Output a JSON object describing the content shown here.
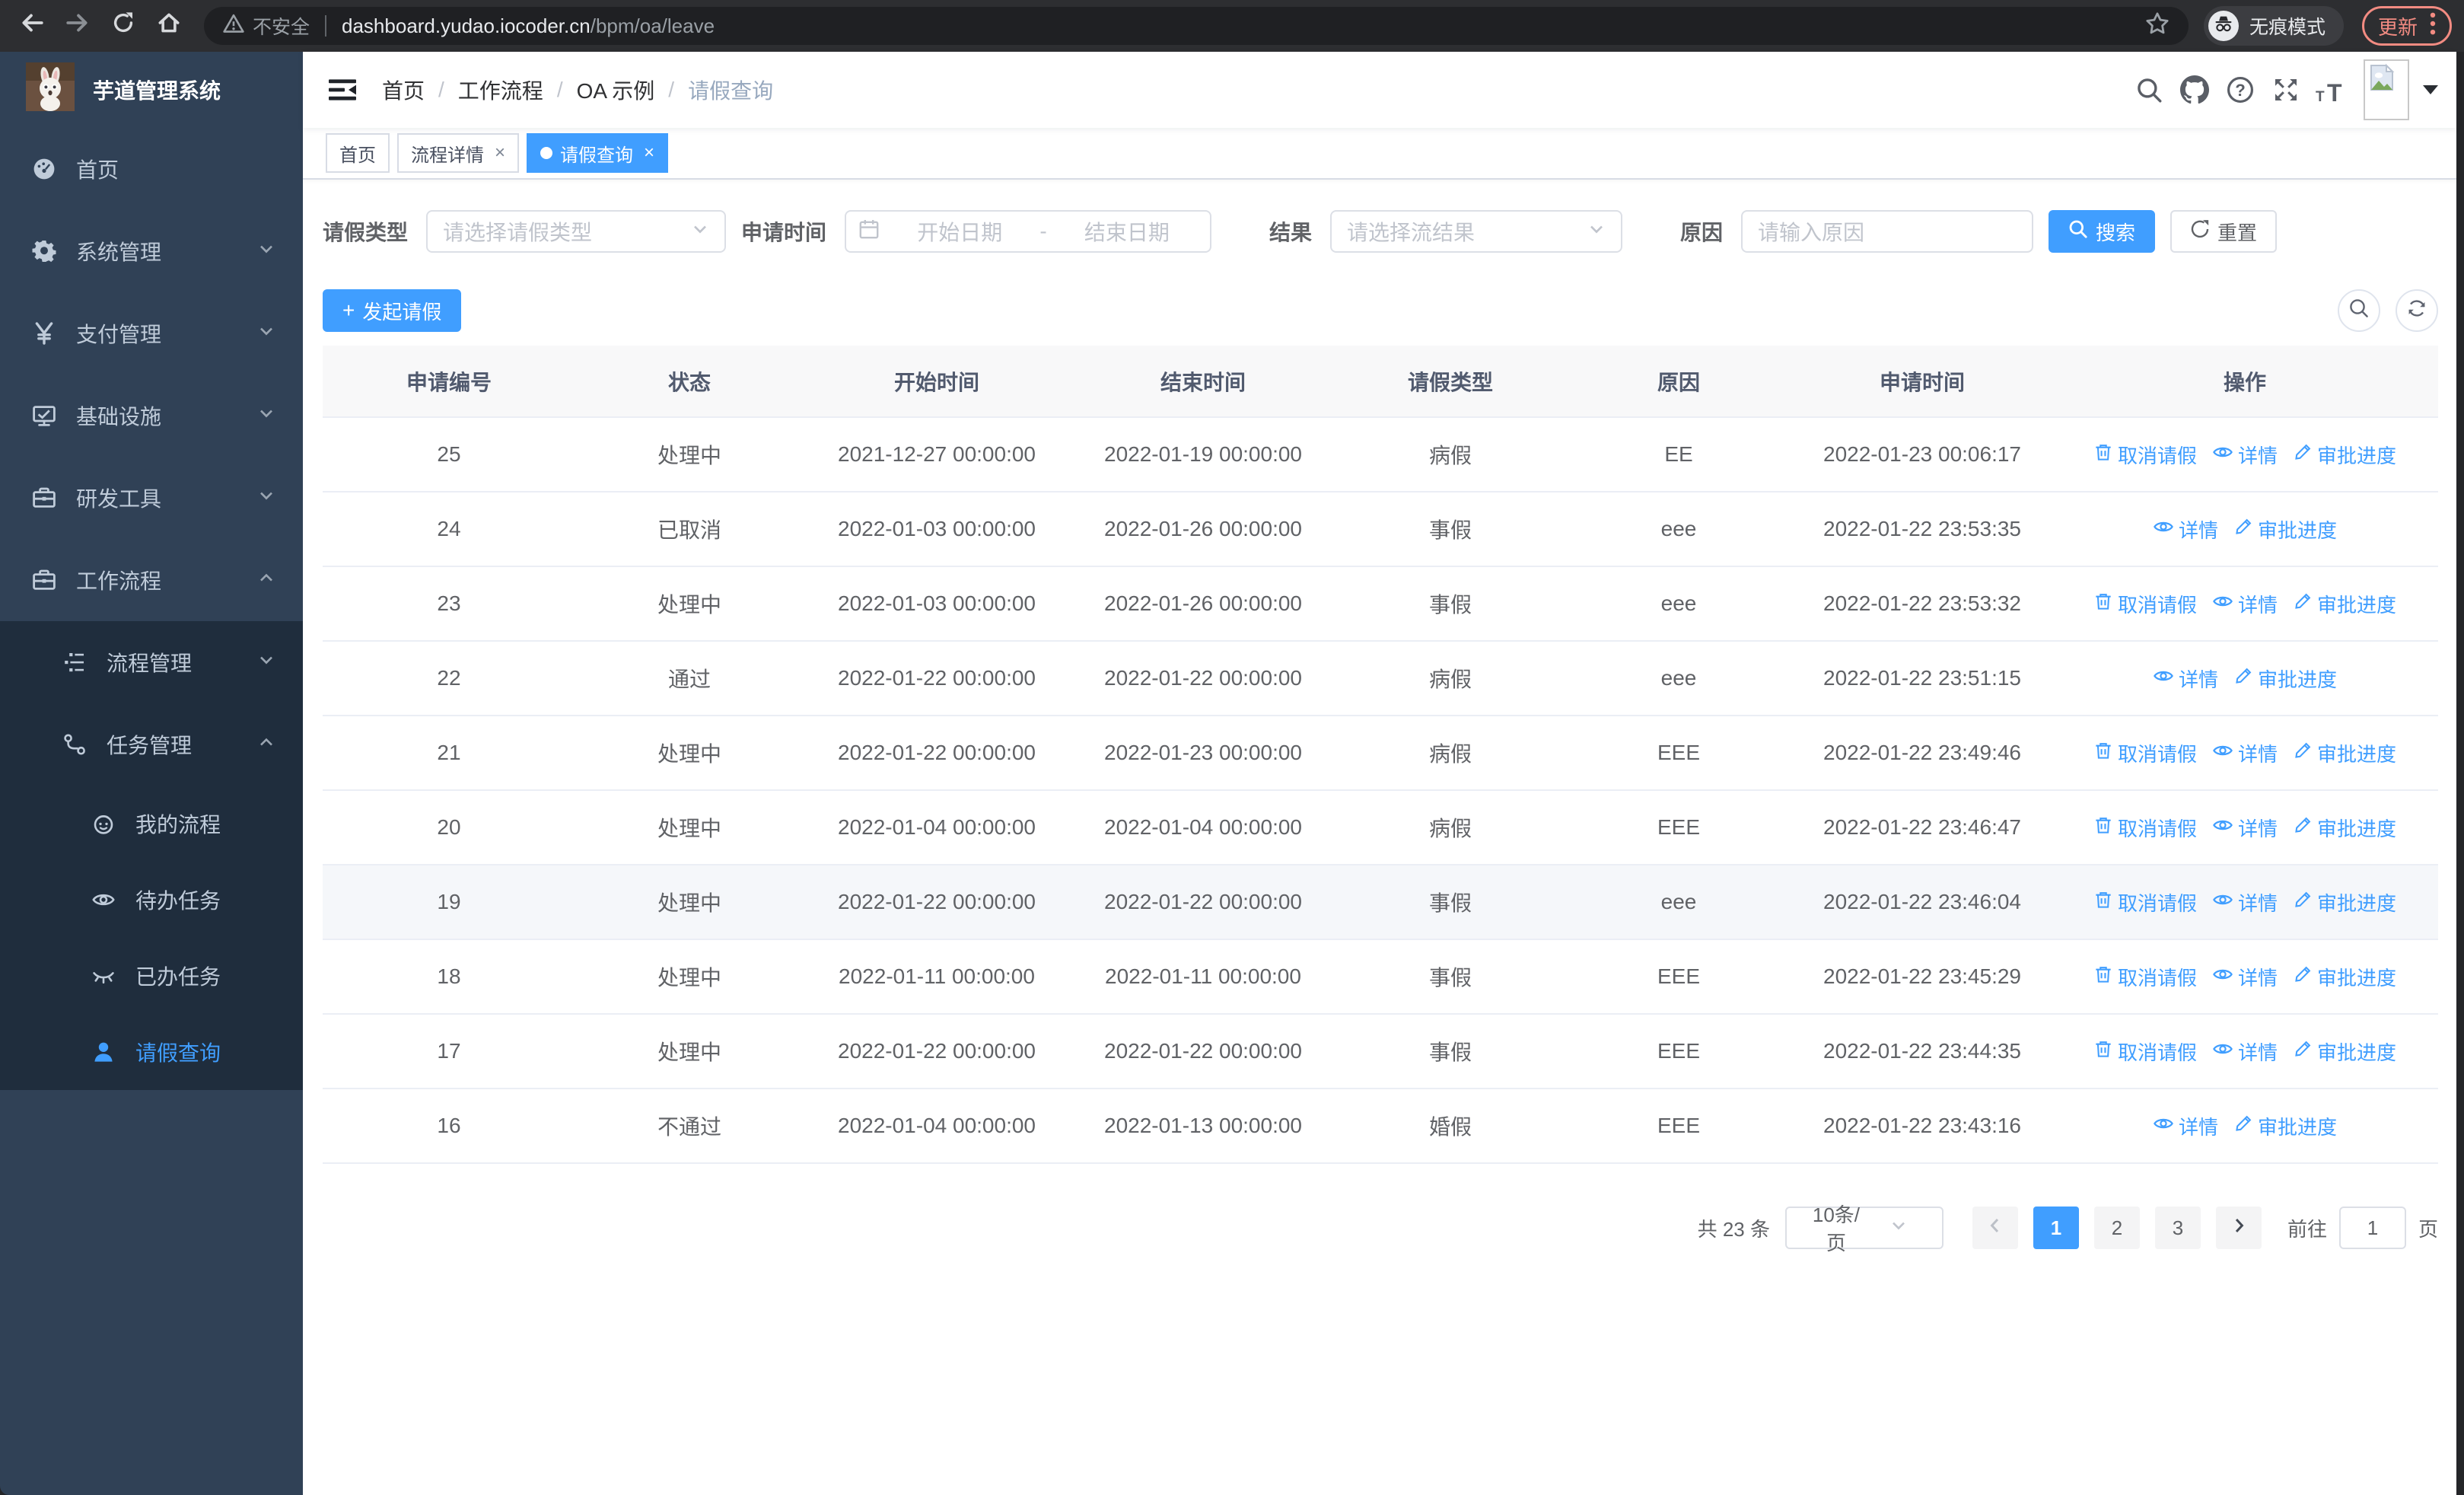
{
  "browser": {
    "security_label": "不安全",
    "url_domain": "dashboard.yudao.iocoder.cn",
    "url_path": "/bpm/oa/leave",
    "incognito_label": "无痕模式",
    "update_label": "更新"
  },
  "sidebar": {
    "title": "芋道管理系统",
    "items": [
      {
        "label": "首页",
        "icon": "dashboard-icon",
        "level": 1,
        "chevron": "",
        "active": false
      },
      {
        "label": "系统管理",
        "icon": "gear-icon",
        "level": 1,
        "chevron": "down",
        "active": false
      },
      {
        "label": "支付管理",
        "icon": "yen-icon",
        "level": 1,
        "chevron": "down",
        "active": false
      },
      {
        "label": "基础设施",
        "icon": "monitor-icon",
        "level": 1,
        "chevron": "down",
        "active": false
      },
      {
        "label": "研发工具",
        "icon": "toolbox-icon",
        "level": 1,
        "chevron": "down",
        "active": false
      },
      {
        "label": "工作流程",
        "icon": "toolbox-icon",
        "level": 1,
        "chevron": "up",
        "active": false
      },
      {
        "label": "流程管理",
        "icon": "list-tree-icon",
        "level": 2,
        "chevron": "down",
        "active": false
      },
      {
        "label": "任务管理",
        "icon": "branch-icon",
        "level": 2,
        "chevron": "up",
        "active": false
      },
      {
        "label": "我的流程",
        "icon": "face-icon",
        "level": 3,
        "chevron": "",
        "active": false
      },
      {
        "label": "待办任务",
        "icon": "eye-open-icon",
        "level": 3,
        "chevron": "",
        "active": false
      },
      {
        "label": "已办任务",
        "icon": "eye-close-icon",
        "level": 3,
        "chevron": "",
        "active": false
      },
      {
        "label": "请假查询",
        "icon": "user-icon",
        "level": 3,
        "chevron": "",
        "active": true
      }
    ]
  },
  "navbar": {
    "breadcrumb": [
      "首页",
      "工作流程",
      "OA 示例",
      "请假查询"
    ]
  },
  "tabs": [
    {
      "label": "首页",
      "closable": false,
      "active": false
    },
    {
      "label": "流程详情",
      "closable": true,
      "active": false
    },
    {
      "label": "请假查询",
      "closable": true,
      "active": true
    }
  ],
  "filters": {
    "type_label": "请假类型",
    "type_placeholder": "请选择请假类型",
    "time_label": "申请时间",
    "start_placeholder": "开始日期",
    "range_separator": "-",
    "end_placeholder": "结束日期",
    "result_label": "结果",
    "result_placeholder": "请选择流结果",
    "reason_label": "原因",
    "reason_placeholder": "请输入原因",
    "search_label": "搜索",
    "reset_label": "重置"
  },
  "actions": {
    "create_label": "发起请假"
  },
  "table": {
    "headers": [
      "申请编号",
      "状态",
      "开始时间",
      "结束时间",
      "请假类型",
      "原因",
      "申请时间",
      "操作"
    ],
    "op_labels": {
      "cancel": "取消请假",
      "detail": "详情",
      "progress": "审批进度"
    },
    "rows": [
      {
        "id": "25",
        "status": "处理中",
        "start": "2021-12-27 00:00:00",
        "end": "2022-01-19 00:00:00",
        "type": "病假",
        "reason": "EE",
        "apply": "2022-01-23 00:06:17",
        "can_cancel": true,
        "highlighted": false
      },
      {
        "id": "24",
        "status": "已取消",
        "start": "2022-01-03 00:00:00",
        "end": "2022-01-26 00:00:00",
        "type": "事假",
        "reason": "eee",
        "apply": "2022-01-22 23:53:35",
        "can_cancel": false,
        "highlighted": false
      },
      {
        "id": "23",
        "status": "处理中",
        "start": "2022-01-03 00:00:00",
        "end": "2022-01-26 00:00:00",
        "type": "事假",
        "reason": "eee",
        "apply": "2022-01-22 23:53:32",
        "can_cancel": true,
        "highlighted": false
      },
      {
        "id": "22",
        "status": "通过",
        "start": "2022-01-22 00:00:00",
        "end": "2022-01-22 00:00:00",
        "type": "病假",
        "reason": "eee",
        "apply": "2022-01-22 23:51:15",
        "can_cancel": false,
        "highlighted": false
      },
      {
        "id": "21",
        "status": "处理中",
        "start": "2022-01-22 00:00:00",
        "end": "2022-01-23 00:00:00",
        "type": "病假",
        "reason": "EEE",
        "apply": "2022-01-22 23:49:46",
        "can_cancel": true,
        "highlighted": false
      },
      {
        "id": "20",
        "status": "处理中",
        "start": "2022-01-04 00:00:00",
        "end": "2022-01-04 00:00:00",
        "type": "病假",
        "reason": "EEE",
        "apply": "2022-01-22 23:46:47",
        "can_cancel": true,
        "highlighted": false
      },
      {
        "id": "19",
        "status": "处理中",
        "start": "2022-01-22 00:00:00",
        "end": "2022-01-22 00:00:00",
        "type": "事假",
        "reason": "eee",
        "apply": "2022-01-22 23:46:04",
        "can_cancel": true,
        "highlighted": true
      },
      {
        "id": "18",
        "status": "处理中",
        "start": "2022-01-11 00:00:00",
        "end": "2022-01-11 00:00:00",
        "type": "事假",
        "reason": "EEE",
        "apply": "2022-01-22 23:45:29",
        "can_cancel": true,
        "highlighted": false
      },
      {
        "id": "17",
        "status": "处理中",
        "start": "2022-01-22 00:00:00",
        "end": "2022-01-22 00:00:00",
        "type": "事假",
        "reason": "EEE",
        "apply": "2022-01-22 23:44:35",
        "can_cancel": true,
        "highlighted": false
      },
      {
        "id": "16",
        "status": "不通过",
        "start": "2022-01-04 00:00:00",
        "end": "2022-01-13 00:00:00",
        "type": "婚假",
        "reason": "EEE",
        "apply": "2022-01-22 23:43:16",
        "can_cancel": false,
        "highlighted": false
      }
    ]
  },
  "pagination": {
    "total_label": "共 23 条",
    "page_size": "10条/页",
    "pages": [
      "1",
      "2",
      "3"
    ],
    "active_page": "1",
    "goto_label": "前往",
    "goto_value": "1",
    "page_unit": "页"
  }
}
